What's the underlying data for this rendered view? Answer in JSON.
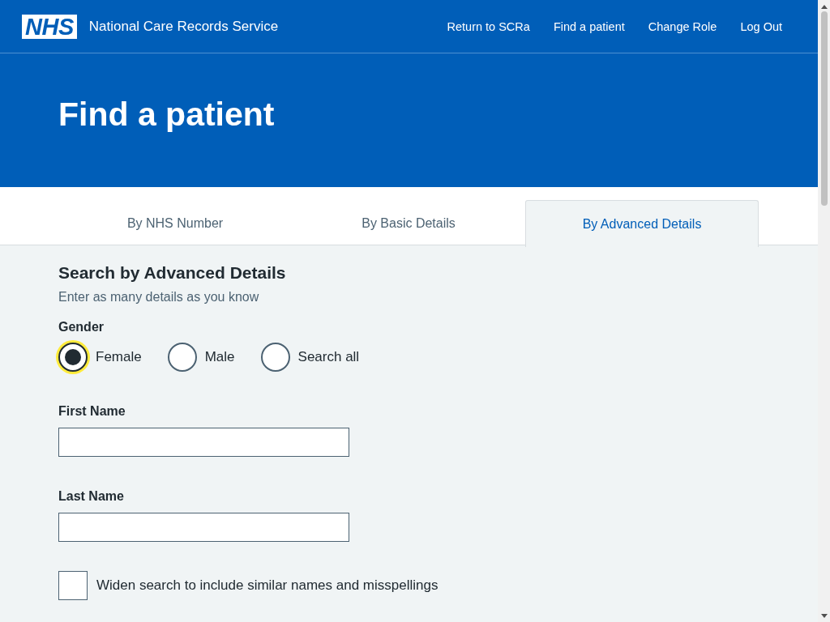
{
  "header": {
    "logo": "NHS",
    "service_name": "National Care Records Service",
    "nav": [
      "Return to SCRa",
      "Find a patient",
      "Change Role",
      "Log Out"
    ]
  },
  "hero": {
    "title": "Find a patient"
  },
  "tabs": [
    {
      "label": "By NHS Number",
      "selected": false
    },
    {
      "label": "By Basic Details",
      "selected": false
    },
    {
      "label": "By Advanced Details",
      "selected": true
    }
  ],
  "form": {
    "heading": "Search by Advanced Details",
    "hint": "Enter as many details as you know",
    "gender": {
      "label": "Gender",
      "options": [
        {
          "label": "Female",
          "selected": true,
          "focused": true
        },
        {
          "label": "Male",
          "selected": false,
          "focused": false
        },
        {
          "label": "Search all",
          "selected": false,
          "focused": false
        }
      ]
    },
    "fields": [
      {
        "label": "First Name"
      },
      {
        "label": "Last Name"
      }
    ],
    "widen": {
      "label": "Widen search to include similar names and misspellings",
      "checked": false
    }
  }
}
